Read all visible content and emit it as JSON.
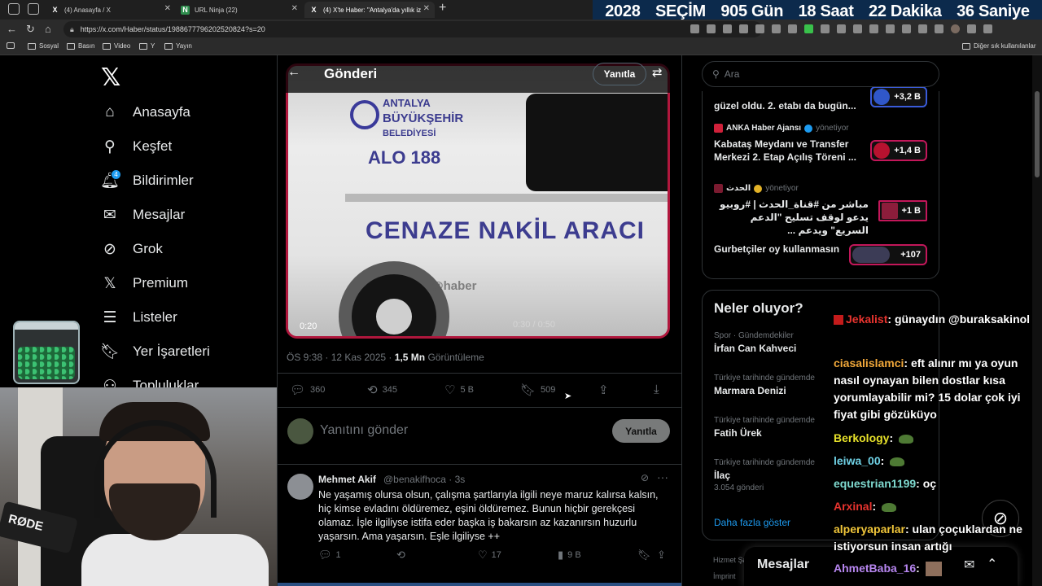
{
  "browser": {
    "tabs": [
      {
        "label": "(4) Anasayfa / X",
        "favicon": "X"
      },
      {
        "label": "URL Ninja (22)",
        "favicon": "N"
      },
      {
        "label": "(4) X'te Haber: \"Antalya'da yıllık iz",
        "favicon": "X"
      }
    ],
    "url": "https://x.com/Haber/status/1988677796202520824?s=20",
    "bookmarks": [
      "Sosyal",
      "Basın",
      "Video",
      "Y",
      "Yayın"
    ],
    "bookmarks_right": "Diğer sık kullanılanlar"
  },
  "countdown": [
    "2028",
    "SEÇİM",
    "905 Gün",
    "18 Saat",
    "22 Dakika",
    "36 Saniye"
  ],
  "nav": {
    "items": [
      "Anasayfa",
      "Keşfet",
      "Bildirimler",
      "Mesajlar",
      "Grok",
      "Premium",
      "Listeler",
      "Yer İşaretleri",
      "Topluluklar"
    ],
    "notification_count": "4"
  },
  "stream": {
    "mic_brand": "RØDE"
  },
  "post": {
    "header_title": "Gönderi",
    "header_reply": "Yanıtla",
    "video": {
      "line1": "ANTALYA",
      "line2": "BÜYÜKŞEHİR",
      "line3": "BELEDİYESİ",
      "alo": "ALO 188",
      "vehicle": "CENAZE NAKİL ARACI",
      "watermark": "@haber",
      "time": "0:20",
      "progress": "0:30 / 0:50"
    },
    "timestamp": "ÖS 9:38 · 12 Kas 2025 ·",
    "views_count": "1,5 Mn",
    "views_label": "Görüntüleme",
    "stats": {
      "replies": "360",
      "reposts": "345",
      "likes": "5 B",
      "bookmarks": "509"
    },
    "reply_placeholder": "Yanıtını gönder",
    "reply_button": "Yanıtla"
  },
  "reply": {
    "name": "Mehmet Akif",
    "handle": "@benakifhoca · 3s",
    "text": "Ne yaşamış olursa olsun, çalışma şartlarıyla ilgili neye maruz kalırsa kalsın, hiç kimse evladını öldüremez, eşini öldüremez. Bunun hiçbir gerekçesi olamaz. İşle ilgiliyse istifa eder başka iş bakarsın az kazanırsın huzurlu yaşarsın. Ama yaşarsın. Eşle ilgiliyse ++",
    "replies": "1",
    "likes": "17",
    "views": "9 B"
  },
  "search": {
    "placeholder": "Ara"
  },
  "spaces": [
    {
      "host": "",
      "status": "",
      "title": "güzel oldu. 2. etabı da bugün...",
      "count": "+3,2 B"
    },
    {
      "host": "ANKA Haber Ajansı",
      "status": "yönetiyor",
      "title": "Kabataş Meydanı ve Transfer Merkezi 2. Etap Açılış Töreni ...",
      "count": "+1,4 B"
    },
    {
      "host": "الحدث",
      "status": "yönetiyor",
      "title": "مباشر من #قناة_الحدث | #روبيو يدعو لوقف تسليح \"الدعم السريع\" ويدعم ...",
      "count": "+1 B"
    },
    {
      "host": "",
      "status": "",
      "title": "Gurbetçiler oy kullanmasın",
      "count": "+107"
    }
  ],
  "trends": {
    "title": "Neler oluyor?",
    "items": [
      {
        "context": "Spor · Gündemdekiler",
        "name": "İrfan Can Kahveci",
        "count": ""
      },
      {
        "context": "Türkiye tarihinde gündemde",
        "name": "Marmara Denizi",
        "count": ""
      },
      {
        "context": "Türkiye tarihinde gündemde",
        "name": "Fatih Ürek",
        "count": ""
      },
      {
        "context": "Türkiye tarihinde gündemde",
        "name": "İlaç",
        "count": "3.054 gönderi"
      }
    ],
    "more": "Daha fazla göster"
  },
  "footer": {
    "line1": "Hizmet Şa",
    "line2": "İmprint"
  },
  "messages": {
    "title": "Mesajlar"
  },
  "chat": [
    {
      "user": "Jekalist",
      "color": "#e8342f",
      "text": "günaydın @buraksakinol"
    },
    {
      "user": "ciasalislamci",
      "color": "#f1a83a",
      "text": "eft alınır mı ya oyun nasıl oynayan bilen dostlar kısa yorumlayabilir mi? 15 dolar çok iyi fiyat gibi gözüküyo"
    },
    {
      "user": "Berkology",
      "color": "#e6e02a",
      "text": ""
    },
    {
      "user": "leiwa_00",
      "color": "#6fd1e5",
      "text": ""
    },
    {
      "user": "equestrian1199",
      "color": "#7fdad0",
      "text": "oç"
    },
    {
      "user": "Arxinal",
      "color": "#e8342f",
      "text": ""
    },
    {
      "user": "alperyaparlar",
      "color": "#f1c63a",
      "text": "ulan çoçuklardan ne istiyorsun insan artığı"
    },
    {
      "user": "AhmetBaba_16",
      "color": "#b786f0",
      "text": ""
    }
  ]
}
